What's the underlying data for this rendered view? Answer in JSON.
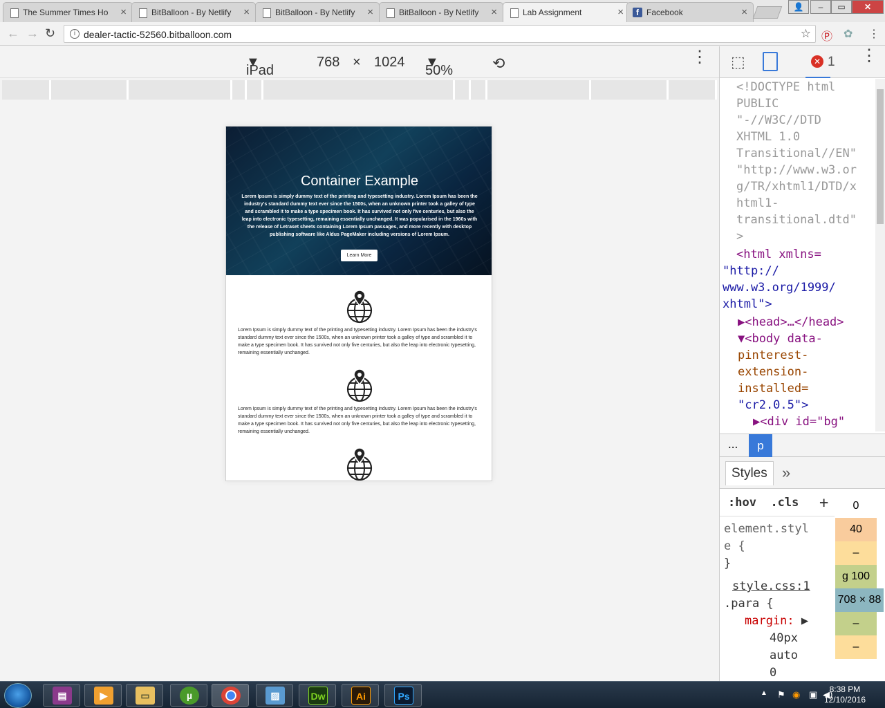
{
  "browser": {
    "tabs": [
      {
        "title": "The Summer Times Ho",
        "icon": "page-icon"
      },
      {
        "title": "BitBalloon - By Netlify",
        "icon": "page-icon"
      },
      {
        "title": "BitBalloon - By Netlify",
        "icon": "page-icon"
      },
      {
        "title": "BitBalloon - By Netlify",
        "icon": "page-icon"
      },
      {
        "title": "Lab Assignment",
        "icon": "page-icon",
        "active": true
      },
      {
        "title": "Facebook",
        "icon": "facebook-icon"
      }
    ],
    "tab_close": "×",
    "url": "dealer-tactic-52560.bitballoon.com"
  },
  "device_toolbar": {
    "device": "iPad",
    "width": "768",
    "times": "×",
    "height": "1024",
    "zoom": "50%"
  },
  "page": {
    "hero_title": "Container Example",
    "hero_text": "Lorem Ipsum is simply dummy text of the printing and typesetting industry. Lorem Ipsum has been the industry's standard dummy text ever since the 1500s, when an unknown printer took a galley of type and scrambled it to make a type specimen book. It has survived not only five centuries, but also the leap into electronic typesetting, remaining essentially unchanged. It was popularised in the 1960s with the release of Letraset sheets containing Lorem Ipsum passages, and more recently with desktop publishing software like Aldus PageMaker including versions of Lorem Ipsum.",
    "hero_button": "Learn More",
    "feature_text": "Lorem Ipsum is simply dummy text of the printing and typesetting industry. Lorem Ipsum has been the industry's standard dummy text ever since the 1500s, when an unknown printer took a galley of type and scrambled it to make a type specimen book. It has survived not only five centuries, but also the leap into electronic typesetting, remaining essentially unchanged."
  },
  "devtools": {
    "error_count": "1",
    "doctype_lines": [
      "<!DOCTYPE html",
      "PUBLIC",
      "\"-//W3C//DTD",
      "XHTML 1.0",
      "Transitional//EN\"",
      "\"http://www.w3.or",
      "g/TR/xhtml1/DTD/x",
      "html1-",
      "transitional.dtd\"",
      ">"
    ],
    "html_tag": "<html xmlns=",
    "html_xmlns_lines": [
      "\"http://",
      "www.w3.org/1999/",
      "xhtml\">"
    ],
    "head": "▶<head>…</head>",
    "body_open": "▼<body data-",
    "body_attr_lines": [
      "pinterest-",
      "extension-",
      "installed="
    ],
    "body_val": "\"cr2.0.5\">",
    "div_line": "▶<div id=\"bg\"",
    "crumb_dots": "...",
    "crumb_selected": "p",
    "styles_tab": "Styles",
    "more_tabs": "»",
    "hov": ":hov",
    "cls": ".cls",
    "plus": "+",
    "element_style_lines": [
      "element.styl",
      "e {",
      "}"
    ],
    "stylesheet": "style.css:1",
    "selector": ".para {",
    "prop": "margin:",
    "prop_values": [
      "40px",
      "auto",
      "0"
    ],
    "box_values": [
      "0",
      "40",
      "–",
      "g 100",
      "708 × 88",
      "–",
      "–"
    ]
  },
  "taskbar": {
    "apps": [
      "winrar",
      "media-player",
      "explorer",
      "utorrent",
      "chrome",
      "photo-viewer",
      "Dw",
      "Ai",
      "Ps"
    ],
    "time": "8:38 PM",
    "date": "12/10/2016"
  },
  "colors": {
    "accent": "#3879d9",
    "hero_dark": "#0b1d33",
    "error": "#d93025"
  }
}
